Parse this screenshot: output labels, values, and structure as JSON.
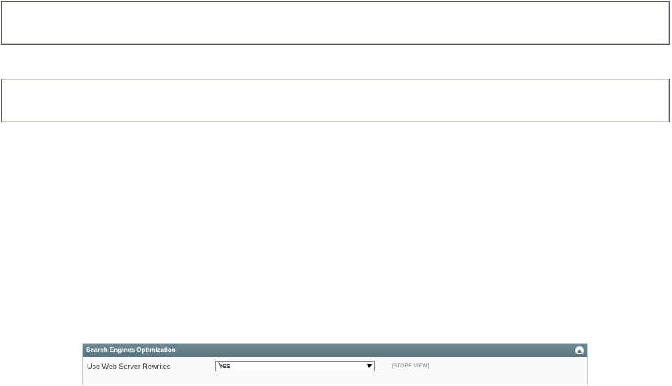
{
  "panel": {
    "title": "Search Engines Optimization",
    "expanded": true,
    "header_color": "#637e88",
    "collapse_icon": "chevron-up-icon"
  },
  "fields": [
    {
      "label": "Use Web Server Rewrites",
      "value": "Yes",
      "scope": "[STORE VIEW]"
    }
  ]
}
